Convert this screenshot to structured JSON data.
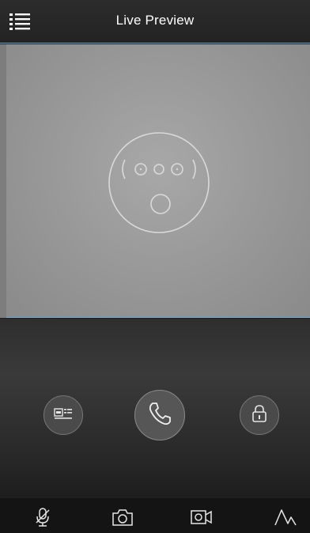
{
  "header": {
    "title": "Live Preview",
    "menu_icon": "menu-list-icon"
  },
  "video": {
    "placeholder_icon": "no-video-face-icon"
  },
  "controls": {
    "playback_icon": "video-record-list-icon",
    "call_icon": "phone-call-icon",
    "unlock_icon": "lock-icon"
  },
  "toolbar": {
    "items": [
      {
        "icon": "microphone-muted-icon"
      },
      {
        "icon": "camera-snapshot-icon"
      },
      {
        "icon": "video-record-icon"
      },
      {
        "icon": "mountain-signal-icon"
      }
    ]
  },
  "colors": {
    "accent_line": "#6aa7d6",
    "icon_stroke": "#e6e6e6",
    "header_bg": "#2a2a2a"
  }
}
